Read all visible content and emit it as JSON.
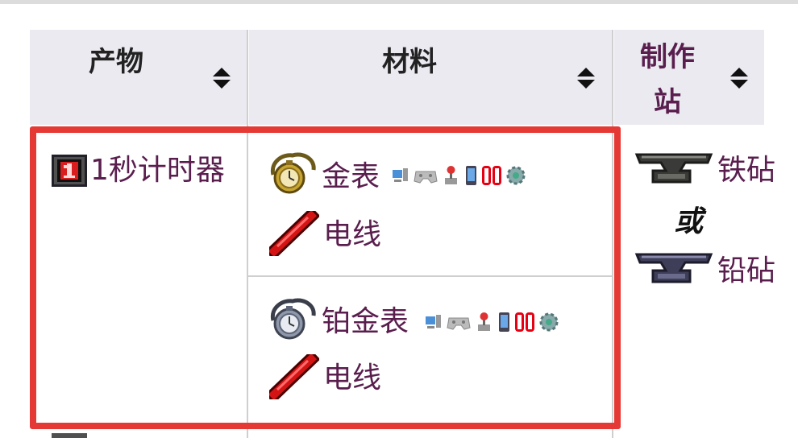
{
  "table": {
    "headers": [
      {
        "label": "产物"
      },
      {
        "label": "材料"
      },
      {
        "label_line1": "制作",
        "label_line2": "站"
      }
    ],
    "row": {
      "product": "1秒计时器",
      "recipes": [
        {
          "ingredients": [
            "金表",
            "电线"
          ]
        },
        {
          "ingredients": [
            "铂金表",
            "电线"
          ]
        }
      ],
      "stations": {
        "first": "铁砧",
        "separator": "或",
        "second": "铅砧"
      }
    }
  },
  "colors": {
    "link": "#5a1e4e",
    "highlight": "#e53935",
    "header_bg": "#eaeaf0"
  },
  "platform_icons": [
    "desktop-icon",
    "console-icon",
    "joystick-icon",
    "mobile-icon",
    "switch-icon",
    "gear-icon"
  ]
}
